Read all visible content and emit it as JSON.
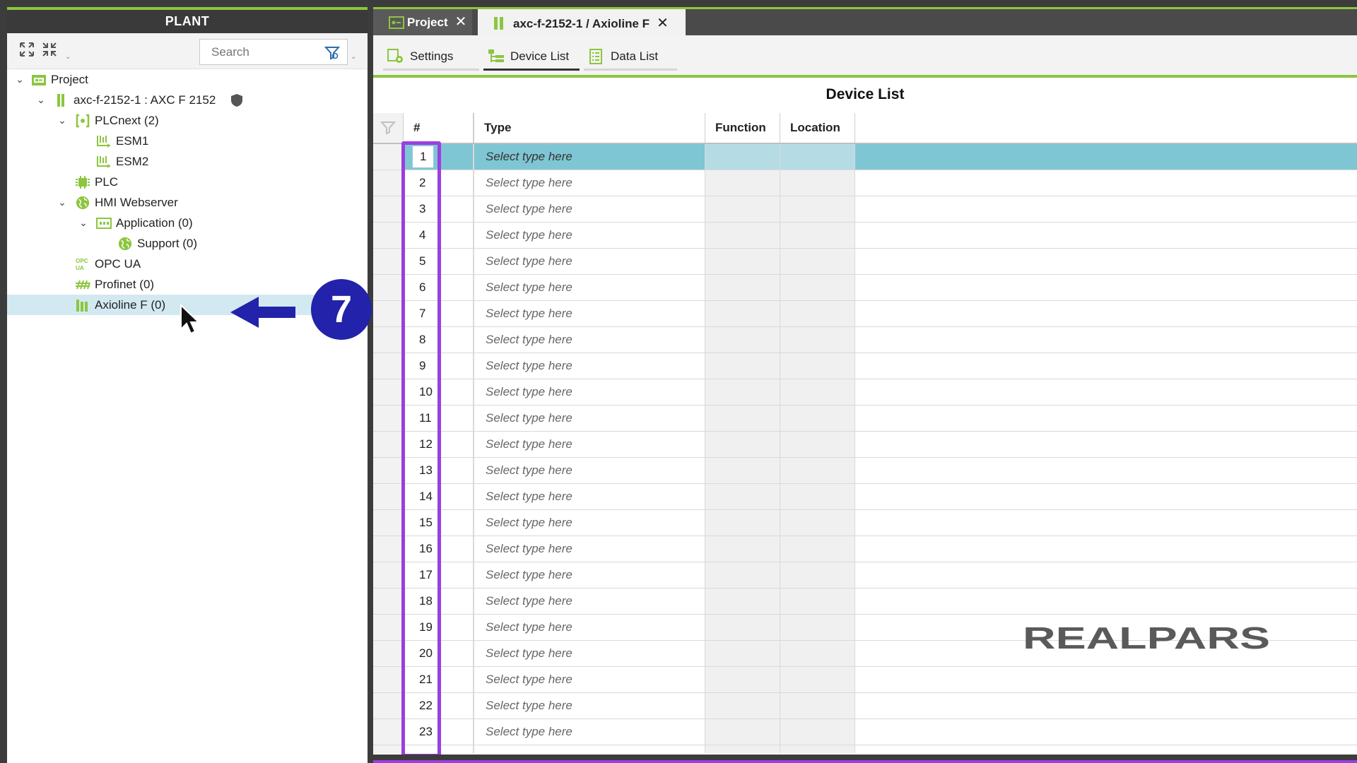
{
  "plant": {
    "title": "PLANT",
    "search_placeholder": "Search",
    "tree": [
      {
        "label": "Project",
        "icon": "project-icon"
      },
      {
        "label": "axc-f-2152-1 : AXC F 2152",
        "icon": "controller-icon"
      },
      {
        "label": "PLCnext (2)",
        "icon": "plcnext-icon"
      },
      {
        "label": "ESM1",
        "icon": "esm-icon"
      },
      {
        "label": "ESM2",
        "icon": "esm-icon"
      },
      {
        "label": "PLC",
        "icon": "chip-icon"
      },
      {
        "label": "HMI Webserver",
        "icon": "globe-icon"
      },
      {
        "label": "Application (0)",
        "icon": "application-icon"
      },
      {
        "label": "Support (0)",
        "icon": "globe-icon"
      },
      {
        "label": "OPC UA",
        "icon": "opcua-icon"
      },
      {
        "label": "Profinet (0)",
        "icon": "profinet-icon"
      },
      {
        "label": "Axioline F (0)",
        "icon": "axioline-icon"
      }
    ],
    "annotation_number": "7"
  },
  "editor": {
    "tabs": [
      {
        "label": "Project",
        "close": "✕"
      },
      {
        "label": "axc-f-2152-1 / Axioline F",
        "close": "✕"
      }
    ],
    "subtabs": [
      {
        "label": "Settings"
      },
      {
        "label": "Device List"
      },
      {
        "label": "Data List"
      }
    ],
    "title": "Device List",
    "columns": {
      "num": "#",
      "type": "Type",
      "function": "Function",
      "location": "Location"
    },
    "placeholder_type": "Select type here",
    "rows": [
      "1",
      "2",
      "3",
      "4",
      "5",
      "6",
      "7",
      "8",
      "9",
      "10",
      "11",
      "12",
      "13",
      "14",
      "15",
      "16",
      "17",
      "18",
      "19",
      "20",
      "21",
      "22",
      "23"
    ]
  },
  "brand": {
    "logo": "REALPARS"
  },
  "colors": {
    "accent": "#8cc63f",
    "selection": "#7ec6d4",
    "highlight": "#9b3fe0",
    "annotation": "#2222aa"
  }
}
